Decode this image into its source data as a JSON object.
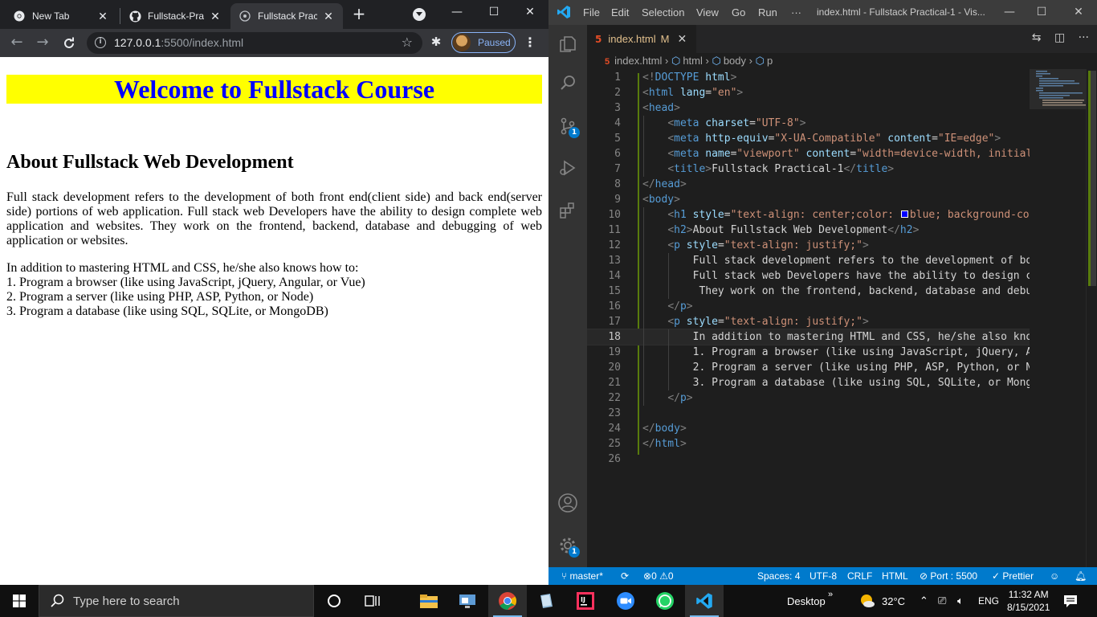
{
  "chrome": {
    "tabs": [
      {
        "label": "New Tab",
        "icon": "chrome-icon"
      },
      {
        "label": "Fullstack-Prac",
        "icon": "github-icon"
      },
      {
        "label": "Fullstack Pract",
        "icon": "globe-icon",
        "active": true
      }
    ],
    "url_host": "127.0.0.1",
    "url_rest": ":5500/index.html",
    "profile_status": "Paused"
  },
  "page": {
    "h1": "Welcome to Fullstack Course",
    "h2": "About Fullstack Web Development",
    "p1": "Full stack development refers to the development of both front end(client side) and back end(server side) portions of web application. Full stack web Developers have the ability to design complete web application and websites. They work on the frontend, backend, database and debugging of web application or websites.",
    "p2_intro": "In addition to mastering HTML and CSS, he/she also knows how to:",
    "p2_items": [
      "1. Program a browser (like using JavaScript, jQuery, Angular, or Vue)",
      "2. Program a server (like using PHP, ASP, Python, or Node)",
      "3. Program a database (like using SQL, SQLite, or MongoDB)"
    ],
    "colors": {
      "h1_text": "#0000ff",
      "h1_bg": "#ffff00"
    }
  },
  "vscode": {
    "menu": [
      "File",
      "Edit",
      "Selection",
      "View",
      "Go",
      "Run",
      "···"
    ],
    "window_title": "index.html - Fullstack Practical-1 - Vis...",
    "tab": {
      "name": "index.html",
      "status": "M"
    },
    "breadcrumb": {
      "file": "index.html",
      "items": [
        "html",
        "body",
        "p"
      ]
    },
    "current_line": 18,
    "status": {
      "branch": "master*",
      "problems": "0",
      "warnings": "0",
      "spaces": "Spaces: 4",
      "encoding": "UTF-8",
      "eol": "CRLF",
      "language": "HTML",
      "port": "Port : 5500",
      "prettier": "Prettier"
    },
    "badges": {
      "scm": "1",
      "settings": "1"
    }
  },
  "taskbar": {
    "search_placeholder": "Type here to search",
    "desktop_label": "Desktop",
    "temperature": "32°C",
    "language": "ENG",
    "time": "11:32 AM",
    "date": "8/15/2021"
  }
}
